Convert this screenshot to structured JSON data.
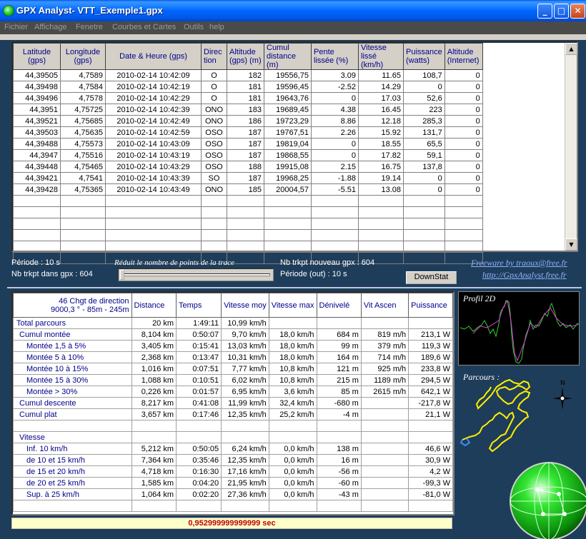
{
  "window": {
    "title": "GPX Analyst- VTT_Exemple1.gpx",
    "minimize": "_",
    "maximize": "□",
    "close": "✕"
  },
  "menu": [
    "Fichier",
    "Affichage",
    "Fenetre",
    "Courbes et Cartes",
    "Outils",
    "help"
  ],
  "trackgrid": {
    "columns": [
      "Latitude (gps)",
      "Longitude (gps)",
      "Date & Heure (gps)",
      "Direc tion",
      "Altitude (gps) (m)",
      "Cumul distance (m)",
      "Pente lissée (%)",
      "Vitesse lissé (km/h)",
      "Puissance (watts)",
      "Altitude (Internet)"
    ],
    "rows": [
      [
        "44,39505",
        "4,7589",
        "2010-02-14 10:42:09",
        "O",
        "182",
        "19556,75",
        "3.09",
        "11.65",
        "108,7",
        "0"
      ],
      [
        "44,39498",
        "4,7584",
        "2010-02-14 10:42:19",
        "O",
        "181",
        "19596,45",
        "-2.52",
        "14.29",
        "0",
        "0"
      ],
      [
        "44,39496",
        "4,7578",
        "2010-02-14 10:42:29",
        "O",
        "181",
        "19643,76",
        "0",
        "17.03",
        "52,6",
        "0"
      ],
      [
        "44,3951",
        "4,75725",
        "2010-02-14 10:42:39",
        "ONO",
        "183",
        "19689,45",
        "4.38",
        "16.45",
        "223",
        "0"
      ],
      [
        "44,39521",
        "4,75685",
        "2010-02-14 10:42:49",
        "ONO",
        "186",
        "19723,29",
        "8.86",
        "12.18",
        "285,3",
        "0"
      ],
      [
        "44,39503",
        "4,75635",
        "2010-02-14 10:42:59",
        "OSO",
        "187",
        "19767,51",
        "2.26",
        "15.92",
        "131,7",
        "0"
      ],
      [
        "44,39488",
        "4,75573",
        "2010-02-14 10:43:09",
        "OSO",
        "187",
        "19819,04",
        "0",
        "18.55",
        "65,5",
        "0"
      ],
      [
        "44,3947",
        "4,75516",
        "2010-02-14 10:43:19",
        "OSO",
        "187",
        "19868,55",
        "0",
        "17.82",
        "59,1",
        "0"
      ],
      [
        "44,39448",
        "4,75465",
        "2010-02-14 10:43:29",
        "OSO",
        "188",
        "19915,08",
        "2.15",
        "16.75",
        "137,8",
        "0"
      ],
      [
        "44,39421",
        "4,7541",
        "2010-02-14 10:43:39",
        "SO",
        "187",
        "19968,25",
        "-1.88",
        "19.14",
        "0",
        "0"
      ],
      [
        "44,39428",
        "4,75365",
        "2010-02-14 10:43:49",
        "ONO",
        "185",
        "20004,57",
        "-5.51",
        "13.08",
        "0",
        "0"
      ]
    ],
    "empty_rows": 6
  },
  "controls": {
    "periode": "Période : 10 s",
    "nb_trkpt_gpx": "Nb trkpt dans gpx : 604",
    "reduce_label": "Réduit le nombre de points de la trace",
    "nb_trkpt_nouveau": "Nb trkpt nouveau gpx : 604",
    "periode_out": "Période (out) : 10 s",
    "downstat_button": "DownStat",
    "freeware_link": "Freeware by traoux@free.fr",
    "site_link": "http://GpxAnalyst.free.fr"
  },
  "stats": {
    "header_line1": "46 Chgt de direction",
    "header_line2": "9000,3 ° - 85m - 245m",
    "columns": [
      "Distance",
      "Temps",
      "Vitesse moy",
      "Vitesse max",
      "Dénivelé",
      "Vit Ascen",
      "Puissance"
    ],
    "rows": [
      {
        "label": "Total parcours",
        "indent": 0,
        "values": [
          "20 km",
          "1:49:11",
          "10,99 km/h",
          "",
          "",
          "",
          ""
        ]
      },
      {
        "label": "Cumul montée",
        "indent": 1,
        "values": [
          "8,104 km",
          "0:50:07",
          "9,70 km/h",
          "18,0 km/h",
          "684 m",
          "819 m/h",
          "213,1 W"
        ]
      },
      {
        "label": "Montée 1,5 à 5%",
        "indent": 2,
        "values": [
          "3,405 km",
          "0:15:41",
          "13,03 km/h",
          "18,0 km/h",
          "99 m",
          "379 m/h",
          "119,3 W"
        ]
      },
      {
        "label": "Montée  5 à 10%",
        "indent": 2,
        "values": [
          "2,368 km",
          "0:13:47",
          "10,31 km/h",
          "18,0 km/h",
          "164 m",
          "714 m/h",
          "189,6 W"
        ]
      },
      {
        "label": "Montée 10 à 15%",
        "indent": 2,
        "values": [
          "1,016 km",
          "0:07:51",
          "7,77 km/h",
          "10,8 km/h",
          "121 m",
          "925 m/h",
          "233,8 W"
        ]
      },
      {
        "label": "Montée 15 à 30%",
        "indent": 2,
        "values": [
          "1,088 km",
          "0:10:51",
          "6,02 km/h",
          "10,8 km/h",
          "215 m",
          "1189 m/h",
          "294,5 W"
        ]
      },
      {
        "label": "Montée  > 30%",
        "indent": 2,
        "values": [
          "0,226 km",
          "0:01:57",
          "6,95 km/h",
          "3,6 km/h",
          "85 m",
          "2615 m/h",
          "642,1 W"
        ]
      },
      {
        "label": "Cumul descente",
        "indent": 1,
        "values": [
          "8,217 km",
          "0:41:08",
          "11,99 km/h",
          "32,4 km/h",
          "-680 m",
          "",
          "-217,8 W"
        ]
      },
      {
        "label": "Cumul plat",
        "indent": 1,
        "values": [
          "3,657 km",
          "0:17:46",
          "12,35 km/h",
          "25,2 km/h",
          "-4 m",
          "",
          "21,1 W"
        ]
      },
      {
        "label": "",
        "indent": 0,
        "values": [
          "",
          "",
          "",
          "",
          "",
          "",
          ""
        ]
      },
      {
        "label": "Vitesse",
        "indent": 1,
        "values": [
          "",
          "",
          "",
          "",
          "",
          "",
          ""
        ]
      },
      {
        "label": "Inf. 10 km/h",
        "indent": 2,
        "values": [
          "5,212 km",
          "0:50:05",
          "6,24 km/h",
          "0,0 km/h",
          "138 m",
          "",
          "46,6 W"
        ]
      },
      {
        "label": "de 10 et 15 km/h",
        "indent": 2,
        "values": [
          "7,364 km",
          "0:35:46",
          "12,35 km/h",
          "0,0 km/h",
          "16 m",
          "",
          "30,9 W"
        ]
      },
      {
        "label": "de 15 et 20 km/h",
        "indent": 2,
        "values": [
          "4,718 km",
          "0:16:30",
          "17,16 km/h",
          "0,0 km/h",
          "-56 m",
          "",
          "4,2 W"
        ]
      },
      {
        "label": "de 20 et 25 km/h",
        "indent": 2,
        "values": [
          "1,585 km",
          "0:04:20",
          "21,95 km/h",
          "0,0 km/h",
          "-60 m",
          "",
          "-99,3 W"
        ]
      },
      {
        "label": "Sup. à 25 km/h",
        "indent": 2,
        "values": [
          "1,064 km",
          "0:02:20",
          "27,36 km/h",
          "0,0 km/h",
          "-43 m",
          "",
          "-81,0 W"
        ]
      },
      {
        "label": "",
        "indent": 0,
        "values": [
          "",
          "",
          "",
          "",
          "",
          "",
          ""
        ]
      }
    ]
  },
  "status": "0,952999999999999 sec",
  "panels": {
    "profile_title": "Profil 2D",
    "parcours_title": "Parcours :",
    "north_label": "N"
  },
  "colors": {
    "profile_line_green": "#2fd12f",
    "profile_line_magenta": "#e040e0",
    "track_yellow": "#ffee00",
    "status_red": "#c00000"
  }
}
